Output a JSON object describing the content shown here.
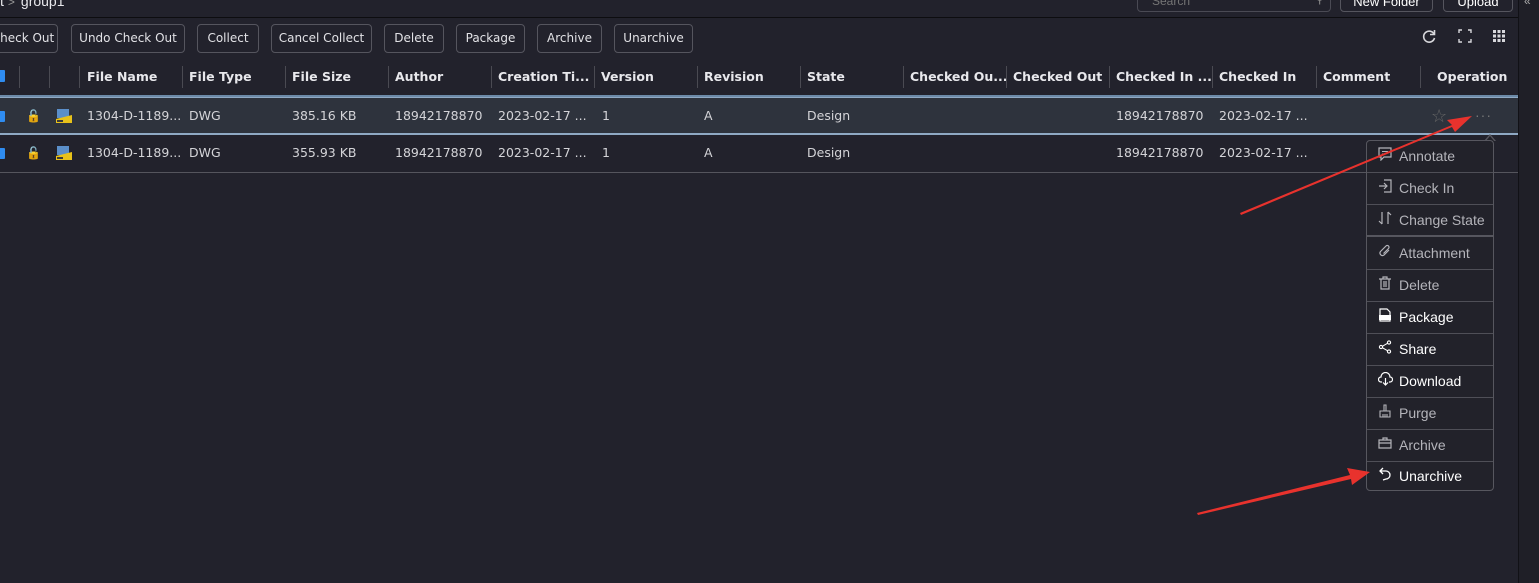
{
  "breadcrumb": {
    "prefix": "t",
    "current": "group1"
  },
  "search": {
    "placeholder": "Search"
  },
  "top_buttons": {
    "new_folder": "New Folder",
    "upload": "Upload"
  },
  "toolbar": {
    "buttons": [
      "Check Out",
      "Undo Check Out",
      "Collect",
      "Cancel Collect",
      "Delete",
      "Package",
      "Archive",
      "Unarchive"
    ],
    "icons": [
      "refresh-icon",
      "fullscreen-icon",
      "grid-settings-icon"
    ]
  },
  "table": {
    "columns": [
      "File Name",
      "File Type",
      "File Size",
      "Author",
      "Creation Ti...",
      "Version",
      "Revision",
      "State",
      "Checked Ou...",
      "Checked Out",
      "Checked In ...",
      "Checked In",
      "Comment",
      "Operation"
    ],
    "rows": [
      {
        "file_name": "1304-D-1189...",
        "file_type": "DWG",
        "file_size": "385.16 KB",
        "author": "18942178870",
        "creation_time": "2023-02-17 ...",
        "version": "1",
        "revision": "A",
        "state": "Design",
        "checked_out_by": "",
        "checked_out": "",
        "checked_in_by": "18942178870",
        "checked_in": "2023-02-17 ...",
        "comment": "",
        "selected": true
      },
      {
        "file_name": "1304-D-1189...",
        "file_type": "DWG",
        "file_size": "355.93 KB",
        "author": "18942178870",
        "creation_time": "2023-02-17 ...",
        "version": "1",
        "revision": "A",
        "state": "Design",
        "checked_out_by": "",
        "checked_out": "",
        "checked_in_by": "18942178870",
        "checked_in": "2023-02-17 ...",
        "comment": "",
        "selected": false
      }
    ]
  },
  "operation_menu": {
    "items": [
      {
        "label": "Annotate",
        "icon": "annotate-icon",
        "glyph": "💬"
      },
      {
        "label": "Check In",
        "icon": "check-in-icon",
        "glyph": "⇥"
      },
      {
        "label": "Change State",
        "icon": "change-state-icon",
        "glyph": "⇅"
      },
      {
        "label": "Attachment",
        "icon": "paperclip-icon",
        "glyph": "📎"
      },
      {
        "label": "Delete",
        "icon": "trash-icon",
        "glyph": "🗑"
      },
      {
        "label": "Package",
        "icon": "zip-file-icon",
        "glyph": "▤"
      },
      {
        "label": "Share",
        "icon": "share-icon",
        "glyph": "<"
      },
      {
        "label": "Download",
        "icon": "cloud-download-icon",
        "glyph": "☁"
      },
      {
        "label": "Purge",
        "icon": "broom-icon",
        "glyph": "⌂"
      },
      {
        "label": "Archive",
        "icon": "archive-box-icon",
        "glyph": "▭"
      },
      {
        "label": "Unarchive",
        "icon": "unarchive-icon",
        "glyph": "↺"
      }
    ]
  },
  "annotation_color": "#e8322d"
}
